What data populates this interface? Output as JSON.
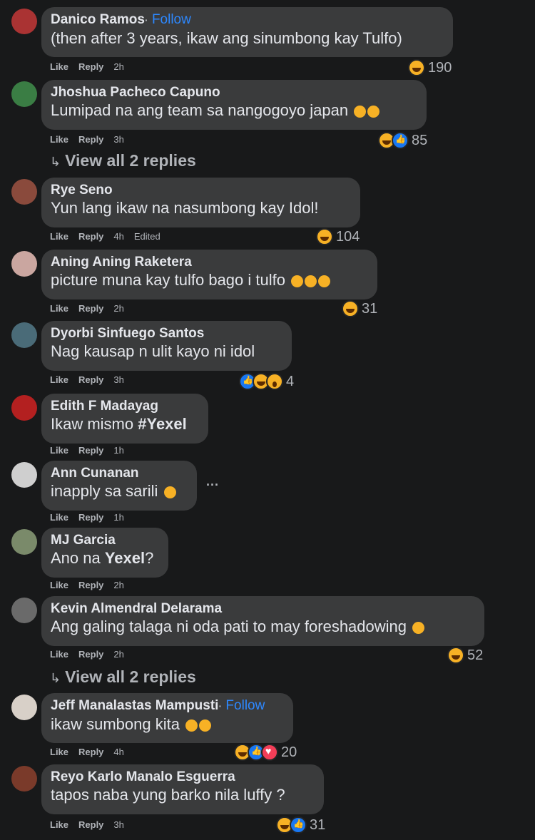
{
  "comments": [
    {
      "name": "Danico Ramos",
      "follow": "Follow",
      "text": "(then after 3 years, ikaw ang sinumbong kay Tulfo)",
      "like": "Like",
      "reply": "Reply",
      "time": "2h",
      "reaction_count": "190",
      "reactions": [
        "haha"
      ],
      "avatar_color": "#a33"
    },
    {
      "name": "Jhoshua Pacheco Capuno",
      "text": "Lumipad na ang team sa nangogoyo japan",
      "like": "Like",
      "reply": "Reply",
      "time": "3h",
      "reaction_count": "85",
      "reactions": [
        "haha",
        "like"
      ],
      "avatar_color": "#3a7d44"
    },
    {
      "name": "Rye Seno",
      "text": "Yun lang ikaw na nasumbong kay Idol!",
      "like": "Like",
      "reply": "Reply",
      "time": "4h",
      "edited": "Edited",
      "reaction_count": "104",
      "reactions": [
        "haha"
      ],
      "avatar_color": "#8a4a3c"
    },
    {
      "name": "Aning Aning Raketera",
      "text": "picture muna kay tulfo bago i tulfo",
      "like": "Like",
      "reply": "Reply",
      "time": "2h",
      "reaction_count": "31",
      "reactions": [
        "haha"
      ],
      "avatar_color": "#caa6a0"
    },
    {
      "name": "Dyorbi Sinfuego Santos",
      "text": "Nag kausap n ulit kayo ni idol",
      "like": "Like",
      "reply": "Reply",
      "time": "3h",
      "reaction_count": "4",
      "reactions": [
        "like",
        "haha",
        "wow"
      ],
      "avatar_color": "#4a6b78"
    },
    {
      "name": "Edith F Madayag",
      "text_prefix": "Ikaw mismo ",
      "text_bold": "#Yexel",
      "like": "Like",
      "reply": "Reply",
      "time": "1h",
      "avatar_color": "#b32020"
    },
    {
      "name": "Ann Cunanan",
      "text": "inapply sa sarili",
      "like": "Like",
      "reply": "Reply",
      "time": "1h",
      "more": "···",
      "avatar_color": "#cfcfcf"
    },
    {
      "name": "MJ Garcia",
      "text_prefix": "Ano na ",
      "text_bold": "Yexel",
      "text_suffix": "?",
      "like": "Like",
      "reply": "Reply",
      "time": "2h",
      "avatar_color": "#7a8a6a"
    },
    {
      "name": "Kevin Almendral Delarama",
      "text": "Ang galing talaga ni oda pati to may foreshadowing",
      "like": "Like",
      "reply": "Reply",
      "time": "2h",
      "reaction_count": "52",
      "reactions": [
        "haha"
      ],
      "avatar_color": "#6a6a6a"
    },
    {
      "name": "Jeff Manalastas Mampusti",
      "follow": "Follow",
      "text": "ikaw sumbong kita",
      "like": "Like",
      "reply": "Reply",
      "time": "4h",
      "reaction_count": "20",
      "reactions": [
        "haha",
        "like",
        "love"
      ],
      "avatar_color": "#d8d0c8"
    },
    {
      "name": "Reyo Karlo Manalo Esguerra",
      "text": "tapos naba yung barko nila luffy ?",
      "like": "Like",
      "reply": "Reply",
      "time": "3h",
      "reaction_count": "31",
      "reactions": [
        "haha",
        "like"
      ],
      "avatar_color": "#7a3a2a"
    }
  ],
  "view_all_1": "View all 2 replies",
  "view_all_2": "View all 2 replies",
  "follow_separator": "·"
}
